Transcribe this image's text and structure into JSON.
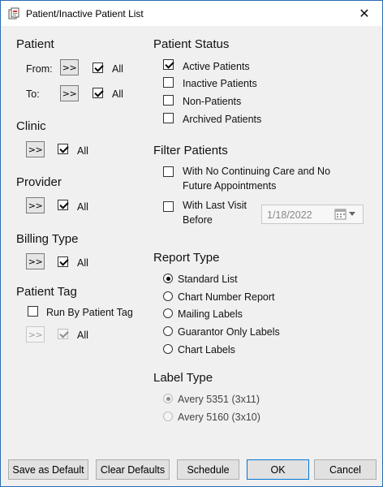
{
  "window": {
    "title": "Patient/Inactive Patient List",
    "close_glyph": "✕"
  },
  "patient": {
    "heading": "Patient",
    "from_label": "From:",
    "to_label": "To:",
    "more_label": ">>",
    "all_label": "All",
    "from_all_checked": true,
    "to_all_checked": true
  },
  "clinic": {
    "heading": "Clinic",
    "more_label": ">>",
    "all_label": "All",
    "all_checked": true
  },
  "provider": {
    "heading": "Provider",
    "more_label": ">>",
    "all_label": "All",
    "all_checked": true
  },
  "billing_type": {
    "heading": "Billing Type",
    "more_label": ">>",
    "all_label": "All",
    "all_checked": true
  },
  "patient_tag": {
    "heading": "Patient Tag",
    "run_by_label": "Run By Patient Tag",
    "run_by_checked": false,
    "more_label": ">>",
    "all_label": "All",
    "all_checked": true
  },
  "patient_status": {
    "heading": "Patient Status",
    "options": [
      {
        "label": "Active Patients",
        "checked": true
      },
      {
        "label": "Inactive Patients",
        "checked": false
      },
      {
        "label": "Non-Patients",
        "checked": false
      },
      {
        "label": "Archived Patients",
        "checked": false
      }
    ]
  },
  "filter_patients": {
    "heading": "Filter Patients",
    "no_continuing_line1": "With No Continuing Care and No",
    "no_continuing_line2": "Future Appointments",
    "last_visit_line1": "With Last Visit",
    "last_visit_line2": "Before",
    "date_value": "1/18/2022"
  },
  "report_type": {
    "heading": "Report Type",
    "options": [
      {
        "label": "Standard List",
        "selected": true
      },
      {
        "label": "Chart Number Report",
        "selected": false
      },
      {
        "label": "Mailing Labels",
        "selected": false
      },
      {
        "label": "Guarantor Only Labels",
        "selected": false
      },
      {
        "label": "Chart Labels",
        "selected": false
      }
    ]
  },
  "label_type": {
    "heading": "Label Type",
    "options": [
      {
        "label": "Avery 5351 (3x11)",
        "selected": true
      },
      {
        "label": "Avery 5160 (3x10)",
        "selected": false
      }
    ]
  },
  "footer": {
    "save_default": "Save as Default",
    "clear_defaults": "Clear Defaults",
    "schedule": "Schedule",
    "ok": "OK",
    "cancel": "Cancel"
  },
  "colors": {
    "accent": "#0078d7",
    "window_border": "#2b6cb0",
    "background": "#f0f0f0"
  },
  "icons": [
    "app-icon",
    "close-icon",
    "calendar-icon",
    "dropdown-arrow-icon"
  ]
}
